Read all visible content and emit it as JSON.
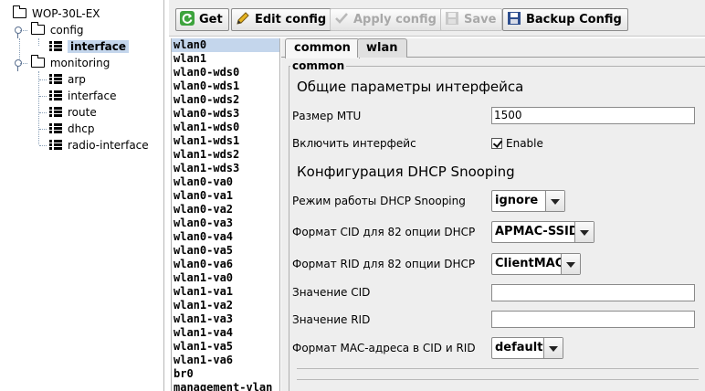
{
  "tree": {
    "root": "WOP-30L-EX",
    "config": "config",
    "interface": "interface",
    "monitoring": "monitoring",
    "monitoring_items": [
      "arp",
      "interface",
      "route",
      "dhcp",
      "radio-interface"
    ]
  },
  "toolbar": {
    "get": "Get",
    "edit": "Edit config",
    "apply": "Apply config",
    "save": "Save",
    "backup": "Backup Config"
  },
  "interfaces": [
    "wlan0",
    "wlan1",
    "wlan0-wds0",
    "wlan0-wds1",
    "wlan0-wds2",
    "wlan0-wds3",
    "wlan1-wds0",
    "wlan1-wds1",
    "wlan1-wds2",
    "wlan1-wds3",
    "wlan0-va0",
    "wlan0-va1",
    "wlan0-va2",
    "wlan0-va3",
    "wlan0-va4",
    "wlan0-va5",
    "wlan0-va6",
    "wlan1-va0",
    "wlan1-va1",
    "wlan1-va2",
    "wlan1-va3",
    "wlan1-va4",
    "wlan1-va5",
    "wlan1-va6",
    "br0",
    "management-vlan"
  ],
  "tabs": {
    "common": "common",
    "wlan": "wlan"
  },
  "group_title": "common",
  "form": {
    "section_general": "Общие параметры интерфейса",
    "mtu_label": "Размер MTU",
    "mtu_value": "1500",
    "enable_label": "Включить интерфейс",
    "enable_text": "Enable",
    "section_dhcp": "Конфигурация DHCP Snooping",
    "dhcp_mode_label": "Режим работы DHCP Snooping",
    "dhcp_mode_value": "ignore",
    "cid_format_label": "Формат CID для 82 опции DHCP",
    "cid_format_value": "APMAC-SSID",
    "rid_format_label": "Формат RID для 82 опции DHCP",
    "rid_format_value": "ClientMAC",
    "cid_value_label": "Значение CID",
    "cid_value": "",
    "rid_value_label": "Значение RID",
    "rid_value": "",
    "mac_format_label": "Формат MAC-адреса в CID и RID",
    "mac_format_value": "default"
  },
  "colors": {
    "selection": "#c4d6ec",
    "panel_bg": "#eeeeee"
  }
}
